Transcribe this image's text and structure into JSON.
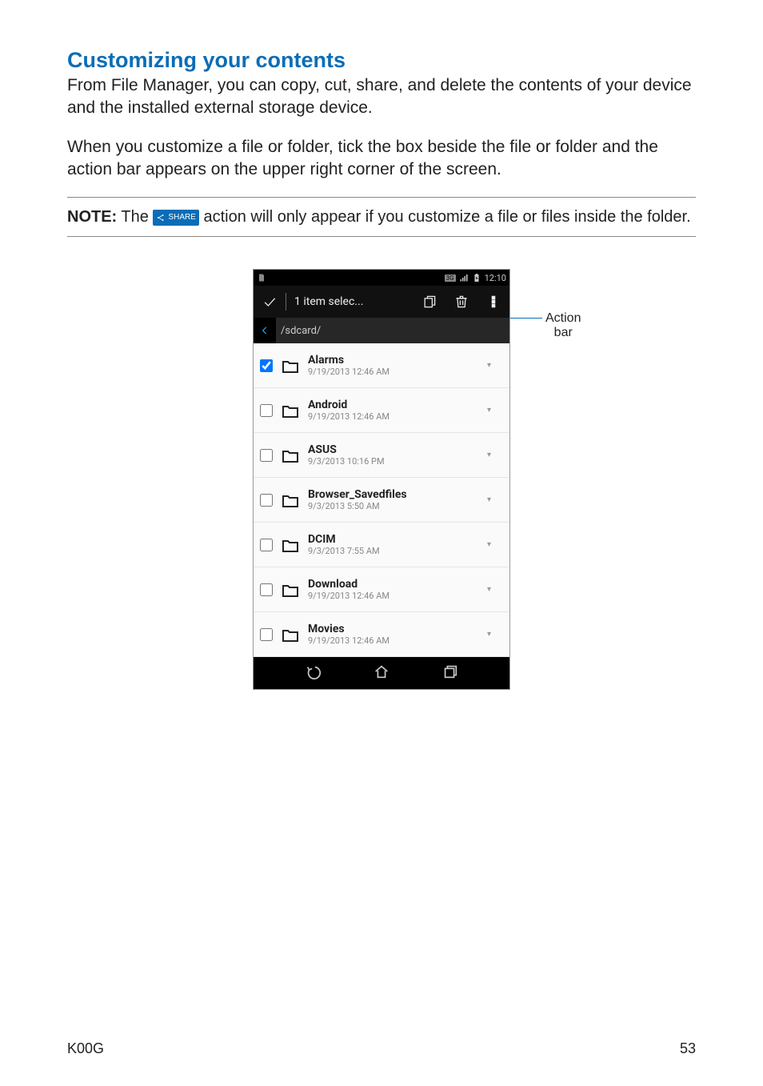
{
  "heading": "Customizing your contents",
  "para1": "From File Manager, you can copy, cut, share, and delete the contents of your device and the installed external storage device.",
  "para2": "When you customize a file or folder, tick the box beside the file or folder and the action bar appears on the upper right corner of the screen.",
  "note": {
    "label": "NOTE:",
    "before": "The",
    "badge": "SHARE",
    "after": "action will only appear if you customize a file or files inside the folder."
  },
  "statusbar": {
    "time": "12:10",
    "net": "3G"
  },
  "actionbar": {
    "title": "1 item selec..."
  },
  "breadcrumb": {
    "path": "/sdcard/"
  },
  "files": [
    {
      "name": "Alarms",
      "meta": "9/19/2013 12:46 AM",
      "checked": true
    },
    {
      "name": "Android",
      "meta": "9/19/2013 12:46 AM",
      "checked": false
    },
    {
      "name": "ASUS",
      "meta": "9/3/2013 10:16 PM",
      "checked": false
    },
    {
      "name": "Browser_Savedfiles",
      "meta": "9/3/2013 5:50 AM",
      "checked": false
    },
    {
      "name": "DCIM",
      "meta": "9/3/2013 7:55 AM",
      "checked": false
    },
    {
      "name": "Download",
      "meta": "9/19/2013 12:46 AM",
      "checked": false
    },
    {
      "name": "Movies",
      "meta": "9/19/2013 12:46 AM",
      "checked": false
    }
  ],
  "callout": "Action bar",
  "footer": {
    "model": "K00G",
    "page": "53"
  }
}
